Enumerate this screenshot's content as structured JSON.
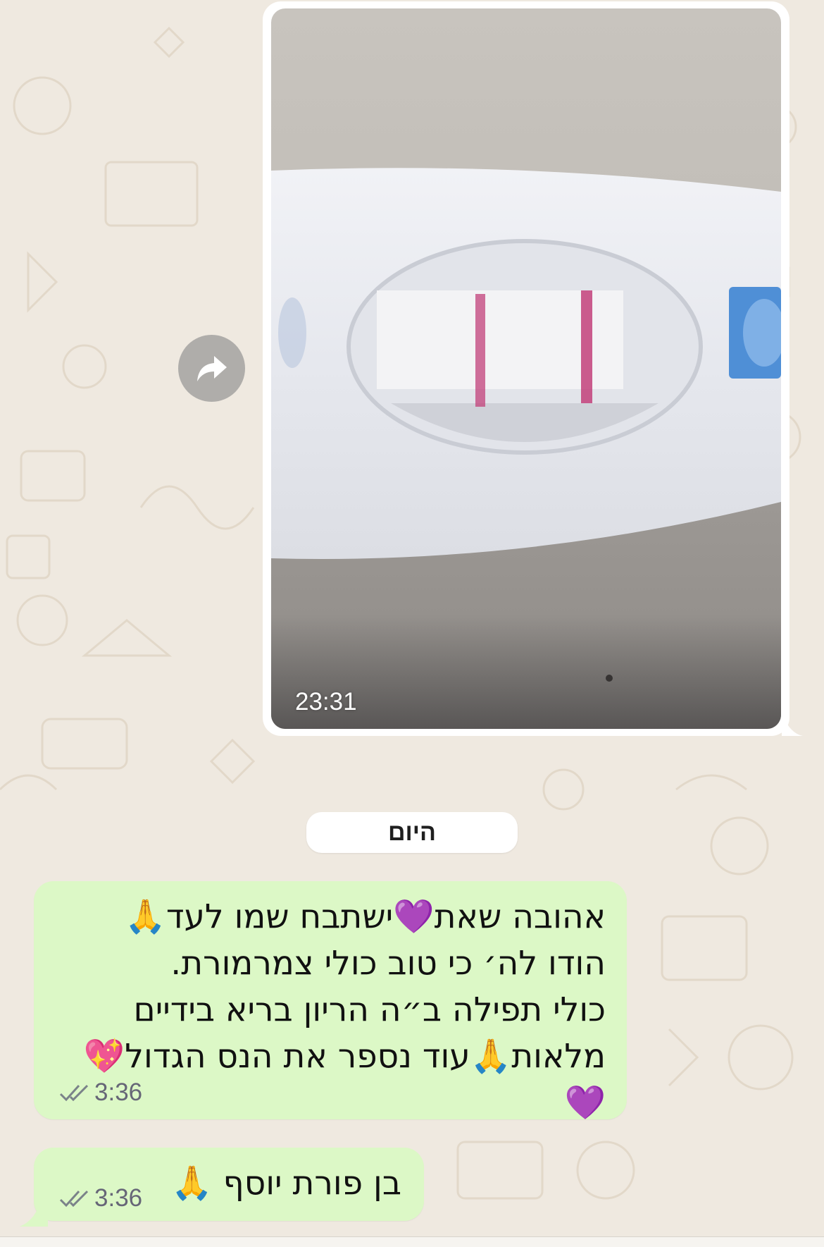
{
  "chat": {
    "image_message": {
      "time": "23:31"
    },
    "date_separator": "היום",
    "messages": [
      {
        "lines": [
          "אהובה שאת💜ישתבח שמו לעד🙏",
          "הודו לה׳ כי טוב כולי צמרמורת.",
          "כולי תפילה ב״ה הריון בריא בידיים",
          "מלאות🙏עוד נספר את הנס הגדול💖",
          "💜"
        ],
        "time": "3:36",
        "status_icon": "double-check-icon"
      },
      {
        "lines": [
          "בן פורת יוסף 🙏"
        ],
        "time": "3:36",
        "status_icon": "double-check-icon"
      }
    ]
  },
  "colors": {
    "outgoing_bubble": "#dcf8c6",
    "background": "#efe9e0",
    "test_line": "#c2407a",
    "test_window_blue": "#4f8fd6"
  }
}
